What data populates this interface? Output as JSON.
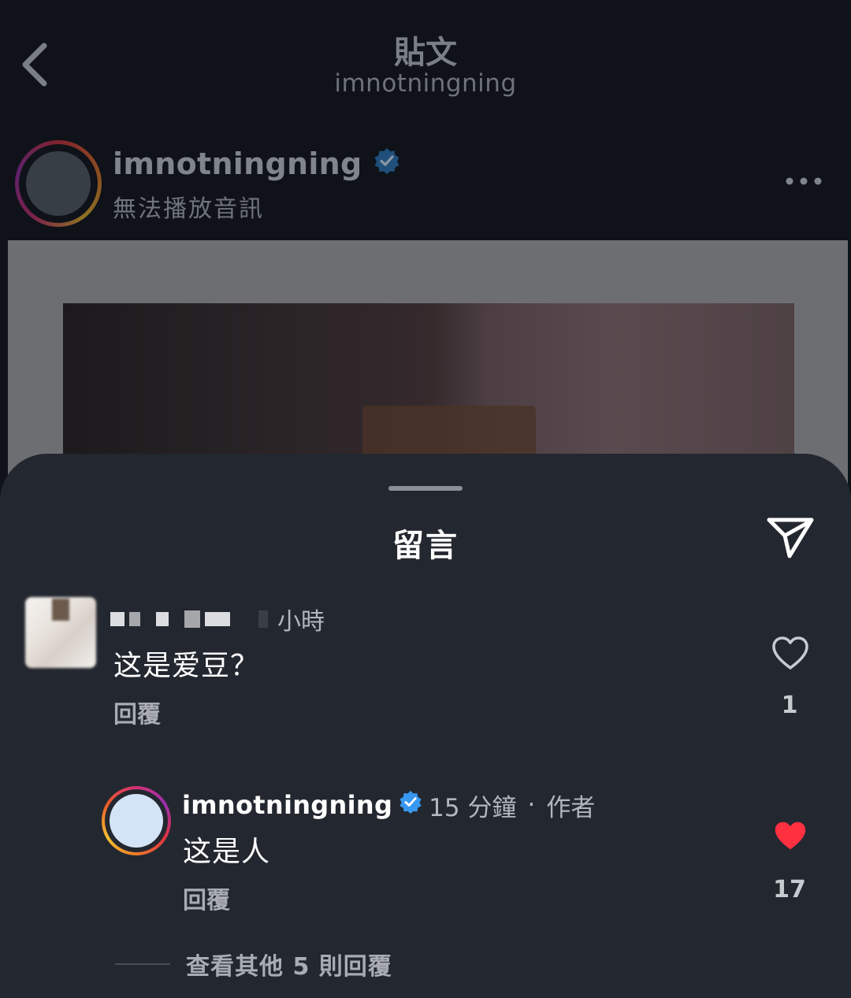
{
  "nav": {
    "title": "貼文",
    "subtitle": "imnotningning"
  },
  "post": {
    "username": "imnotningning",
    "verified": true,
    "audio_status": "無法播放音訊"
  },
  "comments_sheet": {
    "title": "留言",
    "comments": [
      {
        "username": "",
        "time": "小時",
        "text": "这是爱豆？",
        "reply_label": "回覆",
        "likes": "1",
        "liked": false
      },
      {
        "username": "imnotningning",
        "verified": true,
        "time": "15 分鐘",
        "separator": "·",
        "author_tag": "作者",
        "text": "这是人",
        "reply_label": "回覆",
        "likes": "17",
        "liked": true
      }
    ],
    "view_more_replies": "查看其他 5 則回覆"
  },
  "colors": {
    "sheet_bg": "#23272f",
    "like_red": "#ff3040",
    "verified_blue": "#3897f0"
  },
  "icons": [
    "back-chevron-icon",
    "verified-badge-icon",
    "more-icon",
    "send-icon",
    "heart-outline-icon",
    "heart-filled-icon"
  ]
}
